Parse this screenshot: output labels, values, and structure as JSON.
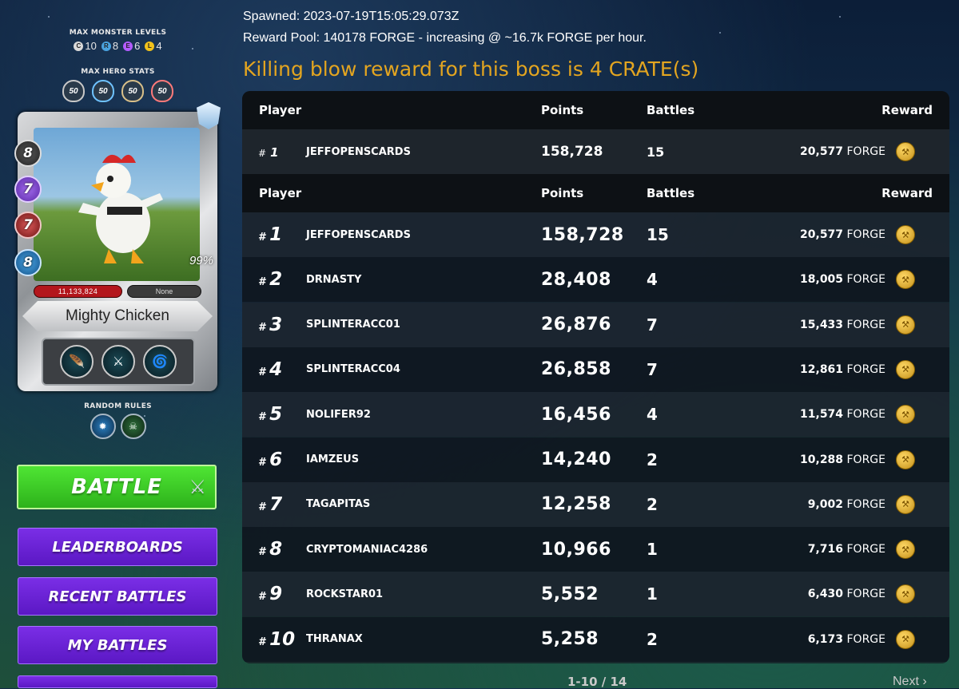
{
  "left": {
    "max_levels_title": "MAX MONSTER LEVELS",
    "levels": [
      {
        "letter": "C",
        "value": "10",
        "color": "#d9d9d9"
      },
      {
        "letter": "R",
        "value": "8",
        "color": "#4aa3e0"
      },
      {
        "letter": "E",
        "value": "6",
        "color": "#b35cff"
      },
      {
        "letter": "L",
        "value": "4",
        "color": "#f2c21b"
      }
    ],
    "hero_title": "MAX HERO STATS",
    "hero_stats": [
      "50",
      "50",
      "50",
      "50"
    ],
    "card": {
      "name": "Mighty Chicken",
      "mana": "8",
      "attack": "7",
      "speed": "7",
      "armor": "8",
      "percent": "99%",
      "health": "11,133,824",
      "shield": "None"
    },
    "random_rules_title": "RANDOM RULES",
    "battle_label": "BATTLE",
    "nav": [
      "LEADERBOARDS",
      "RECENT BATTLES",
      "MY BATTLES"
    ]
  },
  "info": {
    "spawned": "Spawned: 2023-07-19T15:05:29.073Z",
    "reward_pool": "Reward Pool: 140178 FORGE - increasing @ ~16.7k FORGE per hour.",
    "killing_blow": "Killing blow reward for this boss is 4 CRATE(s)"
  },
  "table": {
    "headers": {
      "player": "Player",
      "points": "Points",
      "battles": "Battles",
      "reward": "Reward"
    },
    "currency": "FORGE",
    "top": {
      "hash": "#",
      "rank": "1",
      "name": "JEFFOPENSCARDS",
      "points": "158,728",
      "battles": "15",
      "reward": "20,577"
    },
    "rows": [
      {
        "hash": "#",
        "rank": "1",
        "name": "JEFFOPENSCARDS",
        "points": "158,728",
        "battles": "15",
        "reward": "20,577"
      },
      {
        "hash": "#",
        "rank": "2",
        "name": "DRNASTY",
        "points": "28,408",
        "battles": "4",
        "reward": "18,005"
      },
      {
        "hash": "#",
        "rank": "3",
        "name": "SPLINTERACC01",
        "points": "26,876",
        "battles": "7",
        "reward": "15,433"
      },
      {
        "hash": "#",
        "rank": "4",
        "name": "SPLINTERACC04",
        "points": "26,858",
        "battles": "7",
        "reward": "12,861"
      },
      {
        "hash": "#",
        "rank": "5",
        "name": "NOLIFER92",
        "points": "16,456",
        "battles": "4",
        "reward": "11,574"
      },
      {
        "hash": "#",
        "rank": "6",
        "name": "IAMZEUS",
        "points": "14,240",
        "battles": "2",
        "reward": "10,288"
      },
      {
        "hash": "#",
        "rank": "7",
        "name": "TAGAPITAS",
        "points": "12,258",
        "battles": "2",
        "reward": "9,002"
      },
      {
        "hash": "#",
        "rank": "8",
        "name": "CRYPTOMANIAC4286",
        "points": "10,966",
        "battles": "1",
        "reward": "7,716"
      },
      {
        "hash": "#",
        "rank": "9",
        "name": "ROCKSTAR01",
        "points": "5,552",
        "battles": "1",
        "reward": "6,430"
      },
      {
        "hash": "#",
        "rank": "10",
        "name": "THRANAX",
        "points": "5,258",
        "battles": "2",
        "reward": "6,173"
      }
    ]
  },
  "pagination": {
    "range": "1-10 / 14",
    "next": "Next"
  }
}
